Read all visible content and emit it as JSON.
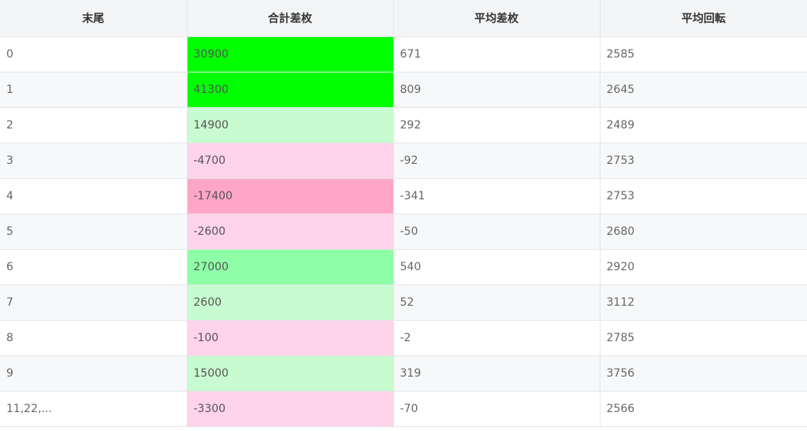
{
  "table": {
    "headers": [
      "末尾",
      "合計差枚",
      "平均差枚",
      "平均回転"
    ],
    "rows": [
      {
        "tail": "0",
        "total": "30900",
        "avg_diff": "671",
        "avg_spin": "2585",
        "color": "#00ff00"
      },
      {
        "tail": "1",
        "total": "41300",
        "avg_diff": "809",
        "avg_spin": "2645",
        "color": "#00ff00"
      },
      {
        "tail": "2",
        "total": "14900",
        "avg_diff": "292",
        "avg_spin": "2489",
        "color": "#c8fbd0"
      },
      {
        "tail": "3",
        "total": "-4700",
        "avg_diff": "-92",
        "avg_spin": "2753",
        "color": "#ffd3e9"
      },
      {
        "tail": "4",
        "total": "-17400",
        "avg_diff": "-341",
        "avg_spin": "2753",
        "color": "#ffa6c8"
      },
      {
        "tail": "5",
        "total": "-2600",
        "avg_diff": "-50",
        "avg_spin": "2680",
        "color": "#ffd3e9"
      },
      {
        "tail": "6",
        "total": "27000",
        "avg_diff": "540",
        "avg_spin": "2920",
        "color": "#8effa6"
      },
      {
        "tail": "7",
        "total": "2600",
        "avg_diff": "52",
        "avg_spin": "3112",
        "color": "#c8fbd0"
      },
      {
        "tail": "8",
        "total": "-100",
        "avg_diff": "-2",
        "avg_spin": "2785",
        "color": "#ffd3e9"
      },
      {
        "tail": "9",
        "total": "15000",
        "avg_diff": "319",
        "avg_spin": "3756",
        "color": "#c8fbd0"
      },
      {
        "tail": "11,22,...",
        "total": "-3300",
        "avg_diff": "-70",
        "avg_spin": "2566",
        "color": "#ffd3e9"
      }
    ]
  }
}
